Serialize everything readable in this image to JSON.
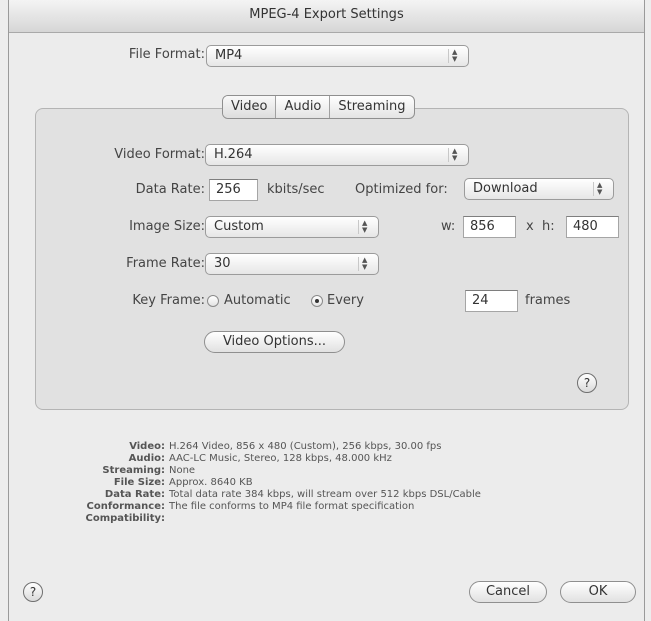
{
  "window": {
    "title": "MPEG-4 Export Settings"
  },
  "file_format": {
    "label": "File Format:",
    "value": "MP4"
  },
  "tabs": [
    {
      "label": "Video",
      "selected": true
    },
    {
      "label": "Audio",
      "selected": false
    },
    {
      "label": "Streaming",
      "selected": false
    }
  ],
  "video": {
    "format_label": "Video Format:",
    "format_value": "H.264",
    "data_rate_label": "Data Rate:",
    "data_rate_value": "256",
    "data_rate_unit": "kbits/sec",
    "optimized_label": "Optimized for:",
    "optimized_value": "Download",
    "image_size_label": "Image Size:",
    "image_size_value": "Custom",
    "width_label": "w:",
    "width_value": "856",
    "height_label": "x  h:",
    "height_value": "480",
    "frame_rate_label": "Frame Rate:",
    "frame_rate_value": "30",
    "key_frame_label": "Key Frame:",
    "key_frame_automatic": "Automatic",
    "key_frame_every": "Every",
    "key_frame_value": "24",
    "key_frame_unit": "frames",
    "key_frame_selected": "Every",
    "options_button": "Video Options..."
  },
  "summary": [
    {
      "key": "Video:",
      "value": "H.264 Video, 856 x 480 (Custom), 256 kbps, 30.00 fps"
    },
    {
      "key": "Audio:",
      "value": "AAC-LC Music, Stereo, 128 kbps, 48.000 kHz"
    },
    {
      "key": "Streaming:",
      "value": "None"
    },
    {
      "key": "File Size:",
      "value": "Approx. 8640 KB"
    },
    {
      "key": "Data Rate:",
      "value": "Total data rate 384 kbps, will stream over 512 kbps DSL/Cable"
    },
    {
      "key": "Conformance:",
      "value": "The file conforms to MP4 file format specification"
    },
    {
      "key": "Compatibility:",
      "value": ""
    }
  ],
  "buttons": {
    "cancel": "Cancel",
    "ok": "OK",
    "help": "?"
  },
  "icons": {
    "help": "question-mark-circle",
    "popup": "up-down-arrows"
  }
}
